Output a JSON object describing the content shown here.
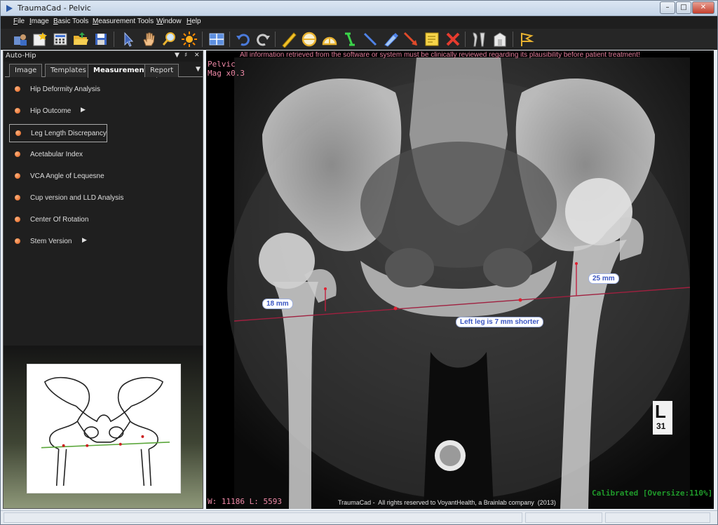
{
  "window": {
    "title": "TraumaCad - Pelvic",
    "controls": [
      "minimize",
      "maximize",
      "close"
    ]
  },
  "menu": [
    "File",
    "Image",
    "Basic Tools",
    "Measurement Tools",
    "Window",
    "Help"
  ],
  "toolbar": {
    "icons": [
      "patient-icon",
      "new-case-icon",
      "calculator-icon",
      "open-folder-icon",
      "save-icon",
      "pointer-icon",
      "pan-hand-icon",
      "zoom-icon",
      "brightness-icon",
      "layout-icon",
      "undo-icon",
      "redo-icon",
      "ruler-icon",
      "circle-icon",
      "angle-icon",
      "distance-icon",
      "line-icon",
      "marker-icon",
      "arrow-icon",
      "note-icon",
      "delete-icon",
      "template-icon",
      "implant-icon",
      "flag-icon"
    ]
  },
  "left_panel": {
    "title": "Auto-Hip",
    "tabs": [
      {
        "label": "Image",
        "active": false
      },
      {
        "label": "Templates",
        "active": false
      },
      {
        "label": "Measurements",
        "active": true
      },
      {
        "label": "Report",
        "active": false
      }
    ],
    "items": [
      {
        "label": "Hip Deformity Analysis",
        "submenu": false,
        "selected": false
      },
      {
        "label": "Hip Outcome",
        "submenu": true,
        "selected": false
      },
      {
        "label": "Leg Length Discrepancy",
        "submenu": false,
        "selected": true
      },
      {
        "label": "Acetabular Index",
        "submenu": false,
        "selected": false
      },
      {
        "label": "VCA Angle of Lequesne",
        "submenu": false,
        "selected": false
      },
      {
        "label": "Cup version and LLD Analysis",
        "submenu": false,
        "selected": false
      },
      {
        "label": "Center Of Rotation",
        "submenu": false,
        "selected": false
      },
      {
        "label": "Stem Version",
        "submenu": true,
        "selected": false
      }
    ]
  },
  "viewer": {
    "study_label": "Pelvic",
    "magnification": "Mag x0.3",
    "warning": "All information retrieved from the software or system must be clinically reviewed regarding its plausibility before patient treatment!",
    "window_level": "W: 11186 L: 5593",
    "calibration_status": "Calibrated [Oversize:110%]",
    "copyright": "TraumaCad -  All rights reserved to VoyantHealth, a Brainlab company  (2013)",
    "marker_letter": "L",
    "marker_number": "31",
    "measurements": {
      "right_label": "18 mm",
      "left_label": "25 mm",
      "result_label": "Left leg is 7 mm shorter"
    },
    "colors": {
      "measure_line": "#a0203f",
      "label_text": "#3a55c2",
      "calibrated_text": "#1f9a2a"
    }
  }
}
